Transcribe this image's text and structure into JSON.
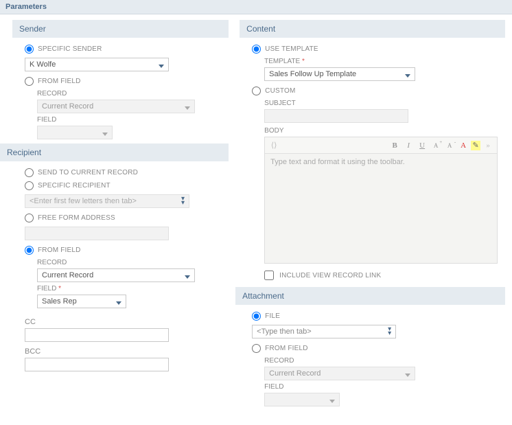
{
  "page": {
    "title": "Parameters"
  },
  "sender": {
    "title": "Sender",
    "opt_specific": "SPECIFIC SENDER",
    "specific_value": "K Wolfe",
    "opt_from_field": "FROM FIELD",
    "record_label": "RECORD",
    "record_value": "Current Record",
    "field_label": "FIELD",
    "field_value": ""
  },
  "recipient": {
    "title": "Recipient",
    "opt_current": "SEND TO CURRENT RECORD",
    "opt_specific": "SPECIFIC RECIPIENT",
    "specific_placeholder": "<Enter first few letters then tab>",
    "opt_freeform": "FREE FORM ADDRESS",
    "freeform_value": "",
    "opt_from_field": "FROM FIELD",
    "record_label": "RECORD",
    "record_value": "Current Record",
    "field_label": "FIELD",
    "field_value": "Sales Rep",
    "cc_label": "CC",
    "cc_value": "",
    "bcc_label": "BCC",
    "bcc_value": ""
  },
  "content": {
    "title": "Content",
    "opt_template": "USE TEMPLATE",
    "template_label": "TEMPLATE",
    "template_value": "Sales Follow Up Template",
    "opt_custom": "CUSTOM",
    "subject_label": "SUBJECT",
    "subject_value": "",
    "body_label": "BODY",
    "body_placeholder": "Type text and format it using the toolbar.",
    "include_link": "INCLUDE VIEW RECORD LINK"
  },
  "attachment": {
    "title": "Attachment",
    "opt_file": "FILE",
    "file_placeholder": "<Type then tab>",
    "opt_from_field": "FROM FIELD",
    "record_label": "RECORD",
    "record_value": "Current Record",
    "field_label": "FIELD",
    "field_value": ""
  }
}
